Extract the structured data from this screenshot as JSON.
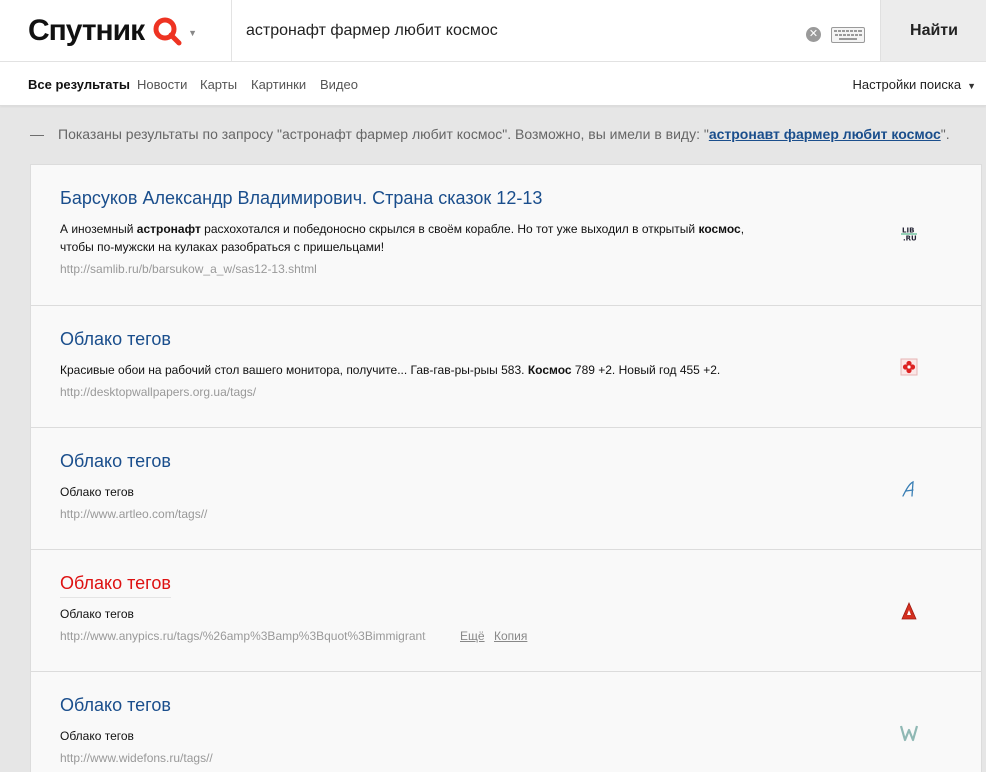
{
  "header": {
    "logo_text": "Спутник",
    "search_value": "астронафт фармер любит космос",
    "find_label": "Найти"
  },
  "nav": {
    "tabs": [
      {
        "label": "Все результаты"
      },
      {
        "label": "Новости"
      },
      {
        "label": "Карты"
      },
      {
        "label": "Картинки"
      },
      {
        "label": "Видео"
      }
    ],
    "settings_label": "Настройки поиска"
  },
  "suggest": {
    "prefix": "Показаны результаты по запросу \"астронафт фармер любит космос\". Возможно, вы имели в виду: \"",
    "link": "астронавт фармер любит космос",
    "suffix": "\"."
  },
  "results": [
    {
      "title": "Барсуков Александр Владимирович. Страна сказок 12-13",
      "snippet_parts": [
        "А иноземный ",
        "астронафт",
        " расхохотался и победоносно скрылся в своём корабле. Но тот уже выходил в открытый ",
        "космос",
        ", чтобы по-мужски на кулаках разобраться с пришельцами!"
      ],
      "url": "http://samlib.ru/b/barsukow_a_w/sas12-13.shtml",
      "favicon": "lib-ru-icon"
    },
    {
      "title": "Облако тегов",
      "snippet_parts": [
        "Красивые обои на рабочий стол вашего монитора, получите... Гав-гав-ры-рыы 583. ",
        "Космос",
        " 789 +2. Новый год 455 +2."
      ],
      "url": "http://desktopwallpapers.org.ua/tags/",
      "favicon": "flower-icon"
    },
    {
      "title": "Облако тегов",
      "snippet": "Облако тегов",
      "url": "http://www.artleo.com/tags//",
      "favicon": "letter-a-script-icon"
    },
    {
      "title": "Облако тегов",
      "snippet": "Облако тегов",
      "url": "http://www.anypics.ru/tags/%26amp%3Bamp%3Bquot%3Bimmigrant",
      "more_label": "Ещё",
      "copy_label": "Копия",
      "favicon": "letter-a-red-icon"
    },
    {
      "title": "Облако тегов",
      "snippet": "Облако тегов",
      "url": "http://www.widefons.ru/tags//",
      "favicon": "letter-w-icon"
    }
  ],
  "colors": {
    "brand_red": "#ee3322",
    "link_blue": "#1a4e8c",
    "visited_red": "#dd1111"
  }
}
